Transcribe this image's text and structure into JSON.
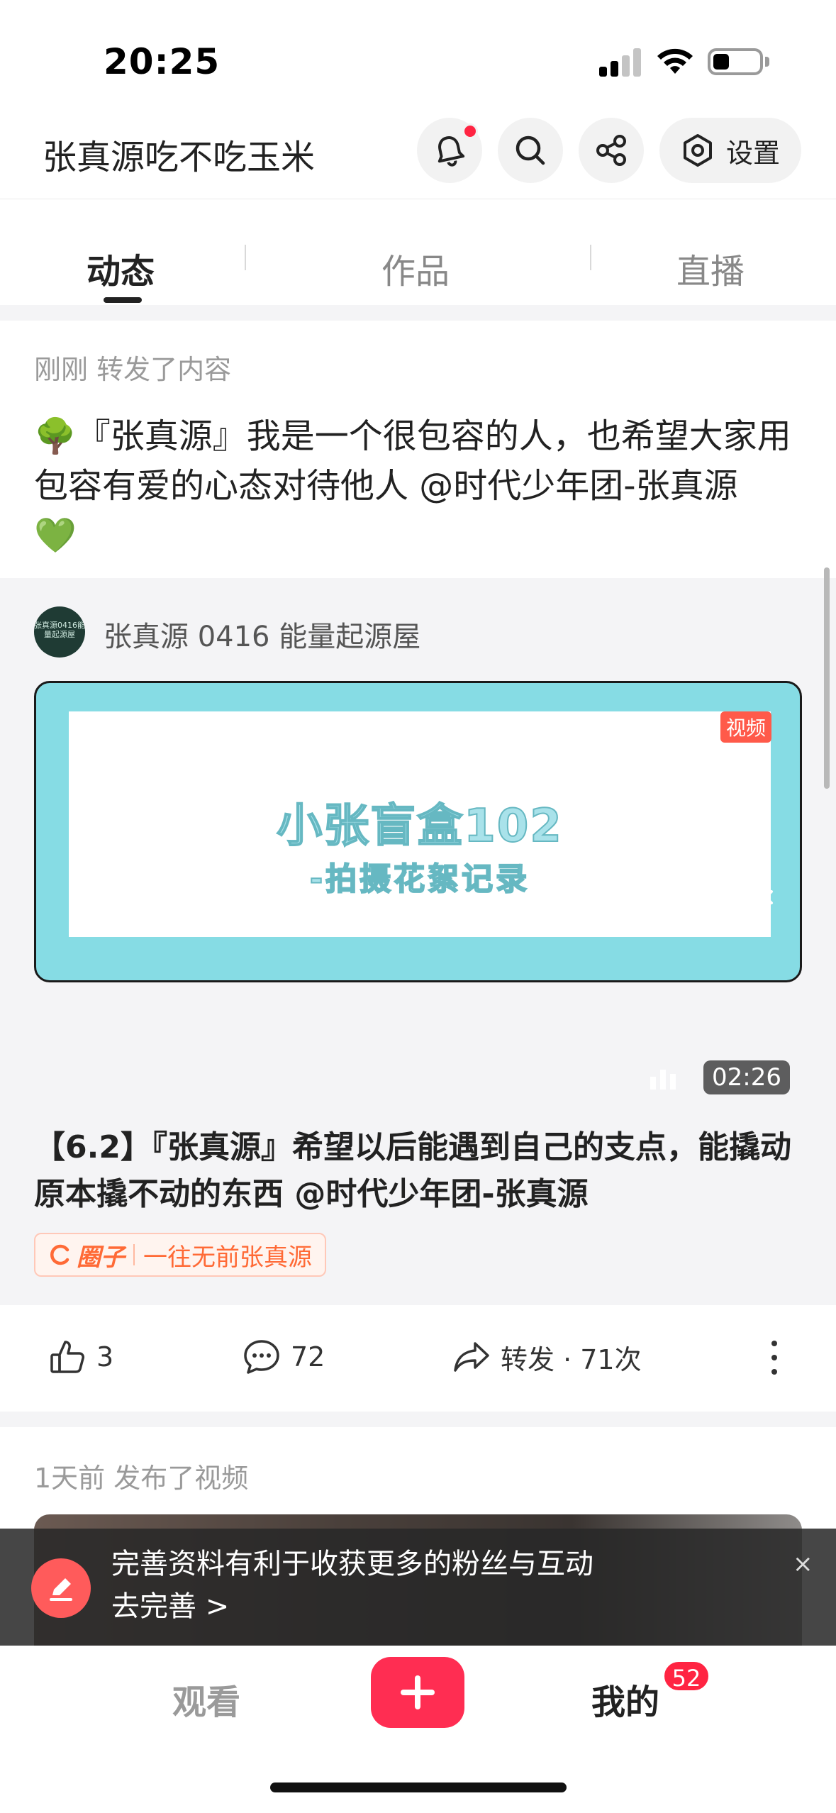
{
  "status_bar": {
    "time": "20:25"
  },
  "header": {
    "title": "张真源吃不吃玉米",
    "settings_label": "设置",
    "icons": [
      "bell-icon",
      "search-icon",
      "share-icon",
      "settings-icon"
    ]
  },
  "tabs": [
    {
      "label": "动态",
      "active": true
    },
    {
      "label": "作品",
      "active": false
    },
    {
      "label": "直播",
      "active": false
    }
  ],
  "post1": {
    "meta": "刚刚 转发了内容",
    "text_line1": "🌳『张真源』我是一个很包容的人，也希望大家用",
    "text_line2": "包容有爱的心态对待他人 @时代少年团-张真源",
    "text_line3": "💚",
    "repost": {
      "author": "张真源 0416 能量起源屋",
      "avatar_text": "张真源0416能量起源屋",
      "video": {
        "title": "小张盲盒102",
        "subtitle": "-拍摄花絮记录",
        "watermark": "视频",
        "emoji": "📷😴🎬",
        "duration": "02:26"
      },
      "text_line1": "【6.2】『张真源』希望以后能遇到自己的支点，能撬动",
      "text_line2": "原本撬不动的东西 @时代少年团-张真源",
      "circle_label": "圈子",
      "circle_name": "一往无前张真源"
    },
    "actions": {
      "likes": "3",
      "comments": "72",
      "repost_label": "转发 · 71次"
    }
  },
  "post2": {
    "meta": "1天前 发布了视频"
  },
  "toast": {
    "line1": "完善资料有利于收获更多的粉丝与互动",
    "line2": "去完善 >",
    "close": "×"
  },
  "bottom_nav": {
    "watch": "观看",
    "me": "我的",
    "badge": "52"
  },
  "colors": {
    "accent": "#ff2442",
    "circle_tag": "#ff6a36"
  }
}
